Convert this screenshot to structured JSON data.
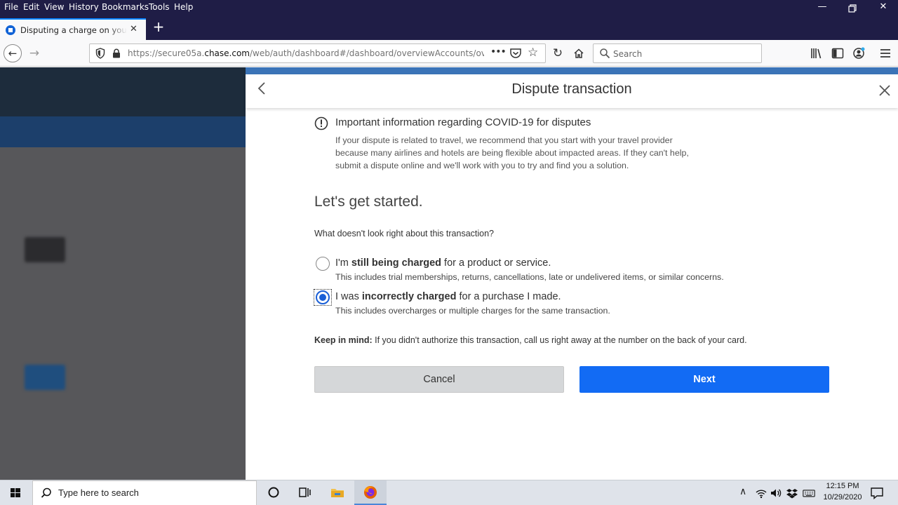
{
  "menubar": {
    "items": [
      "File",
      "Edit",
      "View",
      "History",
      "Bookmarks",
      "Tools",
      "Help"
    ]
  },
  "browser": {
    "tab_title": "Disputing a charge on your card",
    "url_prefix": "https://secure05a.",
    "url_domain": "chase.com",
    "url_path": "/web/auth/dashboard#/dashboard/overviewAccounts/overv",
    "search_placeholder": "Search"
  },
  "dialog": {
    "title": "Dispute transaction",
    "covid_heading": "Important information regarding COVID-19 for disputes",
    "covid_lines": [
      "If your dispute is related to travel, we recommend that you start with your travel provider",
      "because many airlines and hotels are being flexible about impacted areas. If they can't help,",
      "submit a dispute online and we'll work with you to try and find you a solution."
    ],
    "section_heading": "Let's get started.",
    "question": "What doesn't look right about this transaction?",
    "options": [
      {
        "label_pre": "I'm ",
        "label_bold": "still being charged",
        "label_post": " for a product or service.",
        "sub": "This includes trial memberships, returns, cancellations, late or undelivered items, or similar concerns.",
        "selected": false
      },
      {
        "label_pre": "I was ",
        "label_bold": "incorrectly charged",
        "label_post": " for a purchase I made.",
        "sub": "This includes overcharges or multiple charges for the same transaction.",
        "selected": true
      }
    ],
    "keep_in_mind_label": "Keep in mind:",
    "keep_in_mind_text": " If you didn't authorize this transaction, call us right away at the number on the back of your card.",
    "cancel_label": "Cancel",
    "next_label": "Next",
    "primary_color": "#126bf4"
  },
  "taskbar": {
    "search_placeholder": "Type here to search",
    "time": "12:15 PM",
    "date": "10/29/2020"
  }
}
